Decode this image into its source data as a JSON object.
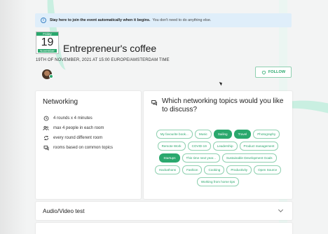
{
  "banner": {
    "bold_text": "Stay here to join the event automatically when it begins.",
    "text": "You don't need to do anything else."
  },
  "event": {
    "day_of_week": "Friday",
    "day": "19",
    "month": "November",
    "title": "Entrepreneur's coffee",
    "datetime": "19TH OF NOVEMBER, 2021 AT 15:00 EUROPE/AMSTERDAM TIME"
  },
  "follow": {
    "label": "FOLLOW"
  },
  "networking": {
    "title": "Networking",
    "items": [
      {
        "icon": "clock-icon",
        "text": "4 rounds x 4 minutes"
      },
      {
        "icon": "people-icon",
        "text": "max 4 people in each room"
      },
      {
        "icon": "refresh-icon",
        "text": "every round different room"
      },
      {
        "icon": "chat-icon",
        "text": "rooms based on common topics"
      }
    ]
  },
  "topics": {
    "title": "Which networking topics would you like to discuss?",
    "chips": [
      {
        "label": "My favourite book...",
        "selected": false
      },
      {
        "label": "Music",
        "selected": false
      },
      {
        "label": "Sailing",
        "selected": true
      },
      {
        "label": "Travel",
        "selected": true
      },
      {
        "label": "Photography",
        "selected": false
      },
      {
        "label": "Remote Work",
        "selected": false
      },
      {
        "label": "COVID-19",
        "selected": false
      },
      {
        "label": "Leadership",
        "selected": false
      },
      {
        "label": "Product management",
        "selected": false
      },
      {
        "label": "Startups",
        "selected": true
      },
      {
        "label": "This time next year...",
        "selected": false
      },
      {
        "label": "Sustainable Development Goals",
        "selected": false
      },
      {
        "label": "Hackathons",
        "selected": false
      },
      {
        "label": "Fashion",
        "selected": false
      },
      {
        "label": "Cooking",
        "selected": false
      },
      {
        "label": "Productivity",
        "selected": false
      },
      {
        "label": "Open Source",
        "selected": false
      },
      {
        "label": "Working from home tips",
        "selected": false
      }
    ]
  },
  "av_test": {
    "label": "Audio/Video test"
  },
  "colors": {
    "accent": "#2aa86d",
    "banner_bg": "#dfeefa",
    "chip_border": "#8fd0b0"
  }
}
